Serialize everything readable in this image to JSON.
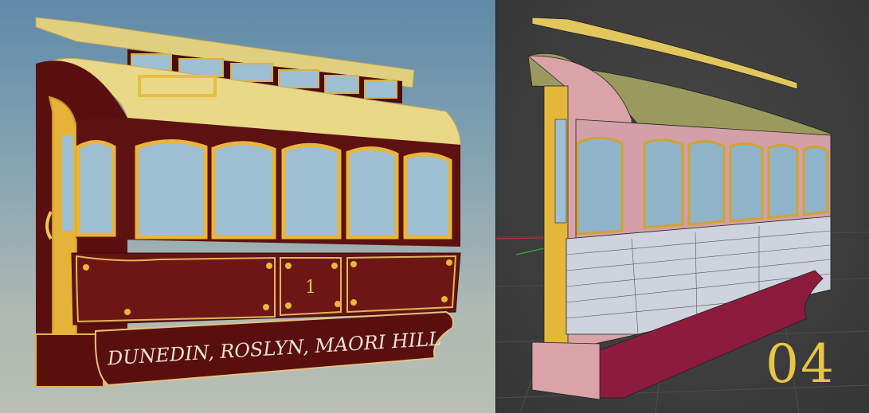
{
  "left_render": {
    "sign_text": "DUNEDIN, ROSLYN, MAORI HILL",
    "car_number": "1"
  },
  "right_viewport": {
    "overlay_number": "04"
  },
  "colors": {
    "maroon": "#5a0f0f",
    "gold": "#e9b53a",
    "cream_roof": "#e6d48a",
    "glass": "#9fc0d2",
    "wire_pink": "#d9a3a8",
    "wire_white": "#cfd3dd",
    "wire_yellow": "#e2c75e",
    "wire_crimson": "#8d1b3e",
    "number_gold": "#e8c545"
  }
}
